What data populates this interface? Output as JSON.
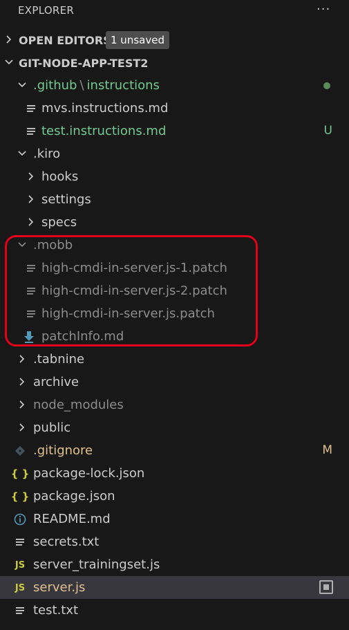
{
  "header": {
    "title": "EXPLORER",
    "more": "···"
  },
  "open_editors": {
    "label": "OPEN EDITORS",
    "badge": "1 unsaved"
  },
  "project": {
    "label": "GIT-NODE-APP-TEST2"
  },
  "tree": {
    "github": {
      "label": ".github",
      "sep": "\\",
      "sub": "instructions"
    },
    "mvs": {
      "label": "mvs.instructions.md"
    },
    "test_instr": {
      "label": "test.instructions.md",
      "status": "U"
    },
    "kiro": {
      "label": ".kiro"
    },
    "hooks": {
      "label": "hooks"
    },
    "settings": {
      "label": "settings"
    },
    "specs": {
      "label": "specs"
    },
    "mobb": {
      "label": ".mobb"
    },
    "patch1": {
      "label": "high-cmdi-in-server.js-1.patch"
    },
    "patch2": {
      "label": "high-cmdi-in-server.js-2.patch"
    },
    "patch3": {
      "label": "high-cmdi-in-server.js.patch"
    },
    "patchinfo": {
      "label": "patchInfo.md"
    },
    "tabnine": {
      "label": ".tabnine"
    },
    "archive": {
      "label": "archive"
    },
    "node_modules": {
      "label": "node_modules"
    },
    "public": {
      "label": "public"
    },
    "gitignore": {
      "label": ".gitignore",
      "status": "M"
    },
    "package_lock": {
      "label": "package-lock.json"
    },
    "package": {
      "label": "package.json"
    },
    "readme": {
      "label": "README.md"
    },
    "secrets": {
      "label": "secrets.txt"
    },
    "server_training": {
      "label": "server_trainingset.js"
    },
    "server": {
      "label": "server.js"
    },
    "test_txt": {
      "label": "test.txt"
    }
  },
  "icons": {
    "js": "JS",
    "json": "{ }"
  },
  "colors": {
    "background": "#181818",
    "selected_row": "#37373d",
    "untracked_green": "#73c991",
    "modified_gold": "#e2c08d",
    "highlight_red": "#e3001b",
    "js_yellow": "#cbcb41"
  }
}
